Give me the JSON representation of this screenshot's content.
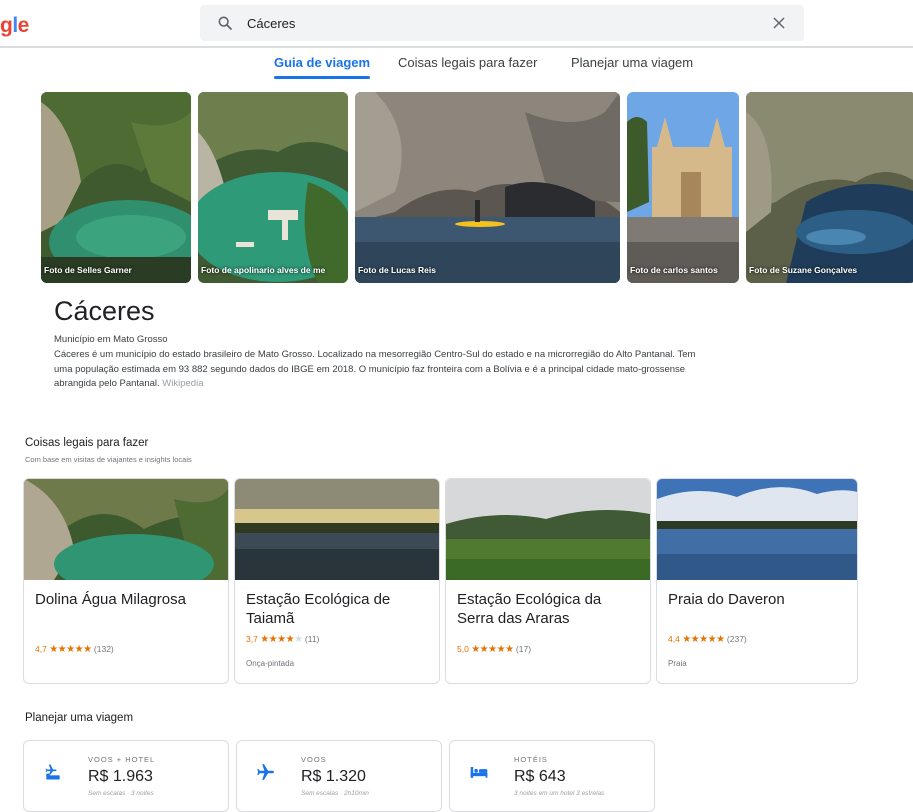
{
  "logo_text": "gle",
  "search": {
    "value": "Cáceres"
  },
  "tabs": [
    "Guia de viagem",
    "Coisas legais para fazer",
    "Planejar uma viagem"
  ],
  "photos": [
    {
      "caption": "Foto de Selles Garner"
    },
    {
      "caption": "Foto de apolinario alves de me"
    },
    {
      "caption": "Foto de Lucas Reis"
    },
    {
      "caption": "Foto de carlos santos"
    },
    {
      "caption": "Foto de Suzane Gonçalves"
    }
  ],
  "place": {
    "title": "Cáceres",
    "subtitle": "Município em Mato Grosso",
    "description": "Cáceres é um município do estado brasileiro de Mato Grosso. Localizado na mesorregião Centro-Sul do estado e na microrregião do Alto Pantanal. Tem uma população estimada em 93 882 segundo dados do IBGE em 2018. O município faz fronteira com a Bolívia e é a principal cidade mato-grossense abrangida pelo Pantanal.",
    "source": "Wikipedia"
  },
  "things_to_do": {
    "title": "Coisas legais para fazer",
    "subtitle": "Com base em visitas de viajantes e insights locais",
    "cards": [
      {
        "name": "Dolina Água Milagrosa",
        "score": "4,7",
        "stars": 4.5,
        "count": "(132)",
        "tag": ""
      },
      {
        "name": "Estação Ecológica de Taiamã",
        "score": "3,7",
        "stars": 3.5,
        "count": "(11)",
        "tag": "Onça-pintada"
      },
      {
        "name": "Estação Ecológica da Serra das Araras",
        "score": "5,0",
        "stars": 5,
        "count": "(17)",
        "tag": ""
      },
      {
        "name": "Praia do Daveron",
        "score": "4,4",
        "stars": 4.5,
        "count": "(237)",
        "tag": "Praia"
      }
    ]
  },
  "plan_trip": {
    "title": "Planejar uma viagem",
    "items": [
      {
        "label": "VOOS + HOTEL",
        "price": "R$ 1.963",
        "detail": "Sem escalas · 3 noites",
        "icon": "flight-hotel-icon"
      },
      {
        "label": "VOOS",
        "price": "R$ 1.320",
        "detail": "Sem escalas · 2h10min",
        "icon": "airplane-icon"
      },
      {
        "label": "HOTÉIS",
        "price": "R$ 643",
        "detail": "3 noites em um hotel 3 estrelas",
        "icon": "bed-icon"
      }
    ]
  },
  "colors": {
    "accent": "#1a73e8",
    "star": "#e37400"
  }
}
